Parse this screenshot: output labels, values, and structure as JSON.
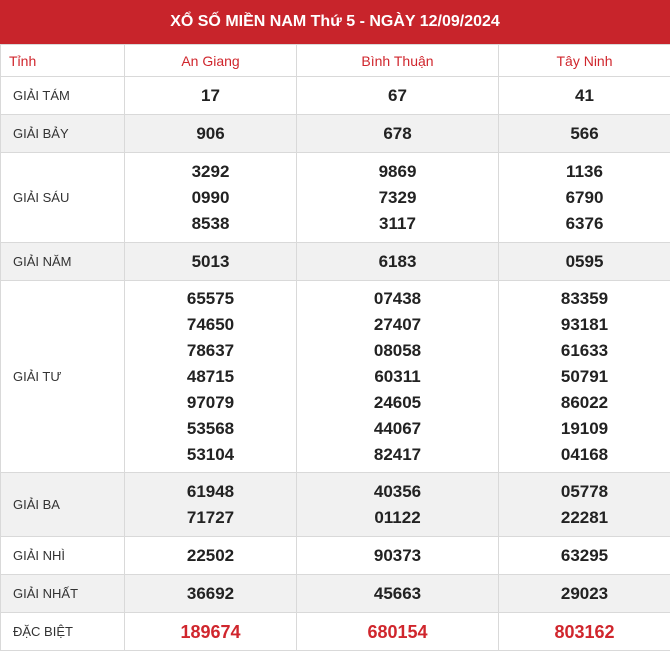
{
  "title": "XỔ SỐ MIỀN NAM Thứ 5 - NGÀY 12/09/2024",
  "header": {
    "col0": "Tỉnh",
    "provinces": [
      "An Giang",
      "Bình Thuận",
      "Tây Ninh"
    ]
  },
  "rows": [
    {
      "label": "GIẢI TÁM",
      "cells": [
        [
          "17"
        ],
        [
          "67"
        ],
        [
          "41"
        ]
      ]
    },
    {
      "label": "GIẢI BẢY",
      "cells": [
        [
          "906"
        ],
        [
          "678"
        ],
        [
          "566"
        ]
      ]
    },
    {
      "label": "GIẢI SÁU",
      "cells": [
        [
          "3292",
          "0990",
          "8538"
        ],
        [
          "9869",
          "7329",
          "3117"
        ],
        [
          "1136",
          "6790",
          "6376"
        ]
      ]
    },
    {
      "label": "GIẢI NĂM",
      "cells": [
        [
          "5013"
        ],
        [
          "6183"
        ],
        [
          "0595"
        ]
      ]
    },
    {
      "label": "GIẢI TƯ",
      "cells": [
        [
          "65575",
          "74650",
          "78637",
          "48715",
          "97079",
          "53568",
          "53104"
        ],
        [
          "07438",
          "27407",
          "08058",
          "60311",
          "24605",
          "44067",
          "82417"
        ],
        [
          "83359",
          "93181",
          "61633",
          "50791",
          "86022",
          "19109",
          "04168"
        ]
      ]
    },
    {
      "label": "GIẢI BA",
      "cells": [
        [
          "61948",
          "71727"
        ],
        [
          "40356",
          "01122"
        ],
        [
          "05778",
          "22281"
        ]
      ]
    },
    {
      "label": "GIẢI NHÌ",
      "cells": [
        [
          "22502"
        ],
        [
          "90373"
        ],
        [
          "63295"
        ]
      ]
    },
    {
      "label": "GIẢI NHẤT",
      "cells": [
        [
          "36692"
        ],
        [
          "45663"
        ],
        [
          "29023"
        ]
      ]
    },
    {
      "label": "ĐẶC BIỆT",
      "cells": [
        [
          "189674"
        ],
        [
          "680154"
        ],
        [
          "803162"
        ]
      ]
    }
  ],
  "colors": {
    "header_bg": "#c8242b",
    "accent_red": "#d0262d",
    "alt_row_bg": "#f1f1f1"
  }
}
